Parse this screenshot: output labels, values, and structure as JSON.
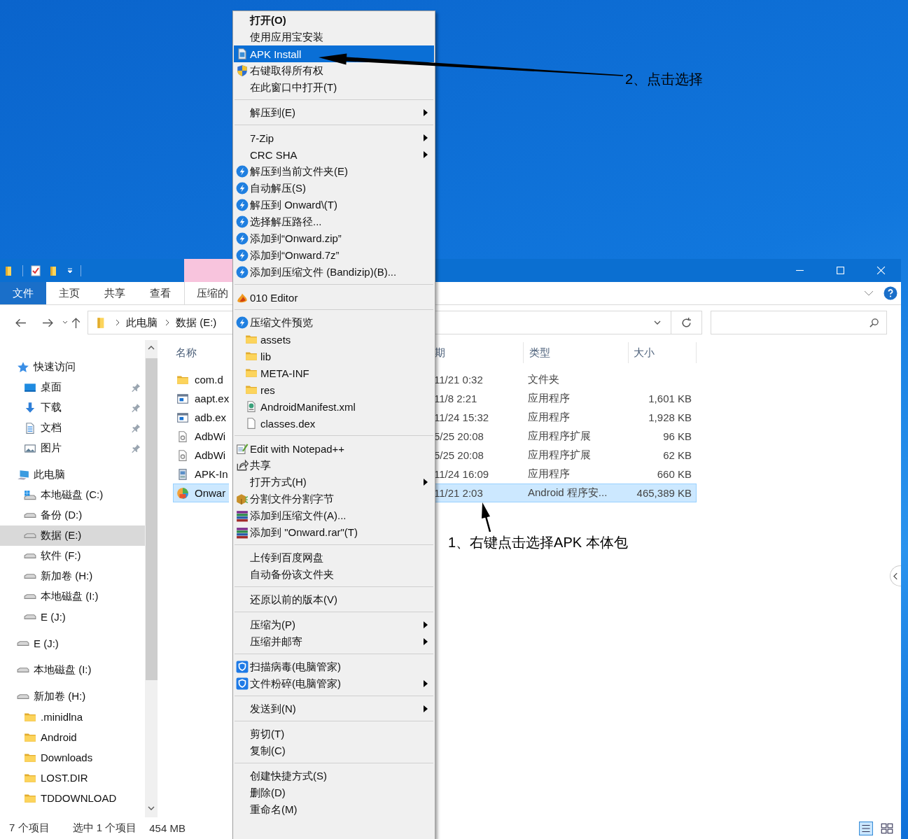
{
  "explorer": {
    "ribbon_tabs": [
      {
        "label": "文件",
        "kind": "file"
      },
      {
        "label": "主页",
        "kind": "tab"
      },
      {
        "label": "共享",
        "kind": "tab"
      },
      {
        "label": "查看",
        "kind": "tab"
      },
      {
        "label": "压缩的",
        "kind": "contextual"
      }
    ],
    "breadcrumbs": [
      "此电脑",
      "数据 (E:)"
    ],
    "sidebar": {
      "items": [
        {
          "label": "快速访问",
          "kind": "star",
          "selected": false,
          "children": [
            {
              "label": "桌面",
              "kind": "desktop",
              "selected": false,
              "pinned": true
            },
            {
              "label": "下载",
              "kind": "download",
              "selected": false,
              "pinned": true
            },
            {
              "label": "文档",
              "kind": "document",
              "selected": false,
              "pinned": true
            },
            {
              "label": "图片",
              "kind": "picture",
              "selected": false,
              "pinned": true
            }
          ]
        },
        {
          "label": "此电脑",
          "kind": "pc",
          "selected": false,
          "children": [
            {
              "label": "本地磁盘 (C:)",
              "kind": "drive-windows",
              "selected": false
            },
            {
              "label": "备份 (D:)",
              "kind": "drive",
              "selected": false
            },
            {
              "label": "数据 (E:)",
              "kind": "drive",
              "selected": true
            },
            {
              "label": "软件 (F:)",
              "kind": "drive",
              "selected": false
            },
            {
              "label": "新加卷 (H:)",
              "kind": "drive",
              "selected": false
            },
            {
              "label": "本地磁盘 (I:)",
              "kind": "drive",
              "selected": false
            },
            {
              "label": "E (J:)",
              "kind": "drive",
              "selected": false
            }
          ]
        },
        {
          "label": "E (J:)",
          "kind": "drive",
          "selected": false
        },
        {
          "label": "本地磁盘 (I:)",
          "kind": "drive",
          "selected": false
        },
        {
          "label": "新加卷 (H:)",
          "kind": "drive",
          "selected": false,
          "children": [
            {
              "label": ".minidlna",
              "kind": "folder",
              "selected": false
            },
            {
              "label": "Android",
              "kind": "folder",
              "selected": false
            },
            {
              "label": "Downloads",
              "kind": "folder",
              "selected": false
            },
            {
              "label": "LOST.DIR",
              "kind": "folder",
              "selected": false
            },
            {
              "label": "TDDOWNLOAD",
              "kind": "folder",
              "selected": false
            }
          ]
        }
      ]
    },
    "columns": [
      "名称",
      "期",
      "类型",
      "大小"
    ],
    "rows": [
      {
        "name": "com.d",
        "date": "11/21 0:32",
        "type": "文件夹",
        "kind": "folder",
        "selected": false
      },
      {
        "name": "aapt.ex",
        "date": "11/8 2:21",
        "type": "应用程序",
        "size": "1,601 KB",
        "kind": "exe",
        "selected": false
      },
      {
        "name": "adb.ex",
        "date": "11/24 15:32",
        "type": "应用程序",
        "size": "1,928 KB",
        "kind": "exe",
        "selected": false
      },
      {
        "name": "AdbWi",
        "date": "5/25 20:08",
        "type": "应用程序扩展",
        "size": "96 KB",
        "kind": "dll",
        "selected": false
      },
      {
        "name": "AdbWi",
        "date": "5/25 20:08",
        "type": "应用程序扩展",
        "size": "62 KB",
        "kind": "dll",
        "selected": false
      },
      {
        "name": "APK-In",
        "date": "11/24 16:09",
        "type": "应用程序",
        "size": "660 KB",
        "kind": "installer",
        "selected": false
      },
      {
        "name": "Onwar",
        "date": "11/21 2:03",
        "type": "Android 程序安...",
        "size": "465,389 KB",
        "kind": "apk",
        "selected": true
      }
    ],
    "status_bar": {
      "count": "7 个项目",
      "selection": "选中 1 个项目",
      "size": "454 MB"
    }
  },
  "context_menu": {
    "groups": [
      [
        {
          "label": "打开(O)",
          "kind": "default",
          "submenu": false,
          "selected": false
        },
        {
          "label": "使用应用宝安装",
          "kind": "plain",
          "submenu": false,
          "selected": false
        },
        {
          "label": "APK Install",
          "kind": "apk-file",
          "submenu": false,
          "selected": true
        },
        {
          "label": "右键取得所有权",
          "kind": "shield",
          "submenu": false,
          "selected": false
        },
        {
          "label": "在此窗口中打开(T)",
          "kind": "plain",
          "submenu": false,
          "selected": false
        }
      ],
      [
        {
          "label": "解压到(E)",
          "kind": "plain",
          "submenu": true,
          "selected": false
        }
      ],
      [
        {
          "label": "7-Zip",
          "kind": "plain",
          "submenu": true,
          "selected": false
        },
        {
          "label": "CRC SHA",
          "kind": "plain",
          "submenu": true,
          "selected": false
        },
        {
          "label": "解压到当前文件夹(E)",
          "kind": "bandizip",
          "submenu": false,
          "selected": false
        },
        {
          "label": "自动解压(S)",
          "kind": "bandizip",
          "submenu": false,
          "selected": false
        },
        {
          "label": "解压到 Onward\\(T)",
          "kind": "bandizip",
          "submenu": false,
          "selected": false
        },
        {
          "label": "选择解压路径...",
          "kind": "bandizip",
          "submenu": false,
          "selected": false
        },
        {
          "label": "添加到“Onward.zip”",
          "kind": "bandizip",
          "submenu": false,
          "selected": false
        },
        {
          "label": "添加到“Onward.7z”",
          "kind": "bandizip",
          "submenu": false,
          "selected": false
        },
        {
          "label": "添加到压缩文件 (Bandizip)(B)...",
          "kind": "bandizip",
          "submenu": false,
          "selected": false
        }
      ],
      [
        {
          "label": "010 Editor",
          "kind": "flame",
          "submenu": false,
          "selected": false
        }
      ],
      [
        {
          "label": "压缩文件预览",
          "kind": "bandizip",
          "submenu": false,
          "selected": false,
          "children": [
            {
              "label": "assets",
              "kind": "folder",
              "submenu": false,
              "selected": false
            },
            {
              "label": "lib",
              "kind": "folder",
              "submenu": false,
              "selected": false
            },
            {
              "label": "META-INF",
              "kind": "folder",
              "submenu": false,
              "selected": false
            },
            {
              "label": "res",
              "kind": "folder",
              "submenu": false,
              "selected": false
            },
            {
              "label": "AndroidManifest.xml",
              "kind": "xml-file",
              "submenu": false,
              "selected": false
            },
            {
              "label": "classes.dex",
              "kind": "file",
              "submenu": false,
              "selected": false
            }
          ]
        }
      ],
      [
        {
          "label": "Edit with Notepad++",
          "kind": "notepad",
          "submenu": false,
          "selected": false
        },
        {
          "label": "共享",
          "kind": "share",
          "submenu": false,
          "selected": false
        },
        {
          "label": "打开方式(H)",
          "kind": "plain",
          "submenu": true,
          "selected": false
        },
        {
          "label": "分割文件分割字节",
          "kind": "package",
          "submenu": false,
          "selected": false
        },
        {
          "label": "添加到压缩文件(A)...",
          "kind": "books",
          "submenu": false,
          "selected": false
        },
        {
          "label": "添加到 \"Onward.rar\"(T)",
          "kind": "books",
          "submenu": false,
          "selected": false
        }
      ],
      [
        {
          "label": "上传到百度网盘",
          "kind": "plain",
          "submenu": false,
          "selected": false
        },
        {
          "label": "自动备份该文件夹",
          "kind": "plain",
          "submenu": false,
          "selected": false
        }
      ],
      [
        {
          "label": "还原以前的版本(V)",
          "kind": "plain",
          "submenu": false,
          "selected": false
        }
      ],
      [
        {
          "label": "压缩为(P)",
          "kind": "plain",
          "submenu": true,
          "selected": false
        },
        {
          "label": "压缩并邮寄",
          "kind": "plain",
          "submenu": true,
          "selected": false
        }
      ],
      [
        {
          "label": "扫描病毒(电脑管家)",
          "kind": "guard",
          "submenu": false,
          "selected": false
        },
        {
          "label": "文件粉碎(电脑管家)",
          "kind": "guard",
          "submenu": true,
          "selected": false
        }
      ],
      [
        {
          "label": "发送到(N)",
          "kind": "plain",
          "submenu": true,
          "selected": false
        }
      ],
      [
        {
          "label": "剪切(T)",
          "kind": "plain",
          "submenu": false,
          "selected": false
        },
        {
          "label": "复制(C)",
          "kind": "plain",
          "submenu": false,
          "selected": false
        }
      ],
      [
        {
          "label": "创建快捷方式(S)",
          "kind": "plain",
          "submenu": false,
          "selected": false
        },
        {
          "label": "删除(D)",
          "kind": "plain",
          "submenu": false,
          "selected": false
        },
        {
          "label": "重命名(M)",
          "kind": "plain",
          "submenu": false,
          "selected": false
        }
      ]
    ]
  },
  "annotations": [
    {
      "text": "1、右键点击选择APK 本体包"
    },
    {
      "text": "2、点击选择"
    }
  ]
}
